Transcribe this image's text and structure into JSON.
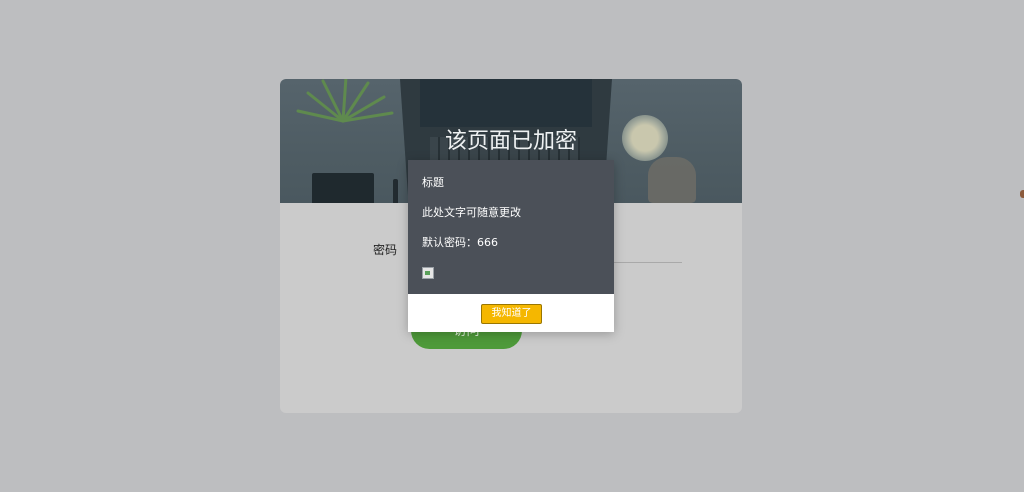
{
  "page": {
    "title": "该页面已加密",
    "password_label": "密码",
    "visit_button": "访问"
  },
  "modal": {
    "title": "标题",
    "message": "此处文字可随意更改",
    "default_password": "默认密码：666",
    "ok_button": "我知道了"
  },
  "colors": {
    "overlay": "#bdbec0",
    "card": "#cbcbcb",
    "visit_button": "#4e9a3a",
    "modal_body": "#4b5058",
    "ok_button": "#f5b700"
  },
  "icons": {
    "broken_image": "broken-image-icon"
  }
}
